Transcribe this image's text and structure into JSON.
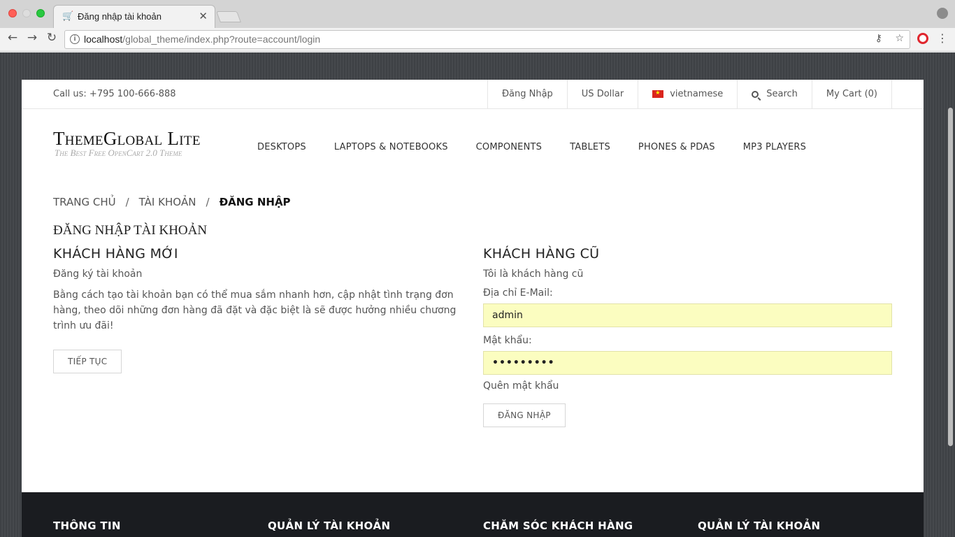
{
  "browser": {
    "tab_title": "Đăng nhập tài khoản",
    "url_host": "localhost",
    "url_path": "/global_theme/index.php?route=account/login"
  },
  "topbar": {
    "call_us": "Call us: +795 100-666-888",
    "items": [
      "Đăng Nhập",
      "US Dollar",
      "vietnamese",
      "Search",
      "My Cart (0)"
    ]
  },
  "logo": {
    "title": "ThemeGlobal Lite",
    "subtitle": "The Best Free OpenCart 2.0 Theme"
  },
  "mainnav": [
    "DESKTOPS",
    "LAPTOPS & NOTEBOOKS",
    "COMPONENTS",
    "TABLETS",
    "PHONES & PDAS",
    "MP3 PLAYERS"
  ],
  "breadcrumb": {
    "home": "TRANG CHỦ",
    "account": "TÀI KHOẢN",
    "current": "ĐĂNG NHẬP",
    "separator": "/"
  },
  "page_title": "ĐĂNG NHẬP TÀI KHOẢN",
  "new_customer": {
    "heading": "KHÁCH HÀNG MỚI",
    "subheading": "Đăng ký tài khoản",
    "text": "Bằng cách tạo tài khoản bạn có thể mua sắm nhanh hơn, cập nhật tình trạng đơn hàng, theo dõi những đơn hàng đã đặt và đặc biệt là sẽ được hưởng nhiều chương trình ưu đãi!",
    "button": "TIẾP TỤC"
  },
  "returning_customer": {
    "heading": "KHÁCH HÀNG CŨ",
    "subheading": "Tôi là khách hàng cũ",
    "email_label": "Địa chỉ E-Mail:",
    "email_value": "admin",
    "password_label": "Mật khẩu:",
    "password_value": "•••••••••",
    "forgot": "Quên mật khẩu",
    "button": "ĐĂNG NHẬP"
  },
  "footer": {
    "columns": [
      "THÔNG TIN",
      "QUẢN LÝ TÀI KHOẢN",
      "CHĂM SÓC KHÁCH HÀNG",
      "QUẢN LÝ TÀI KHOẢN"
    ]
  }
}
